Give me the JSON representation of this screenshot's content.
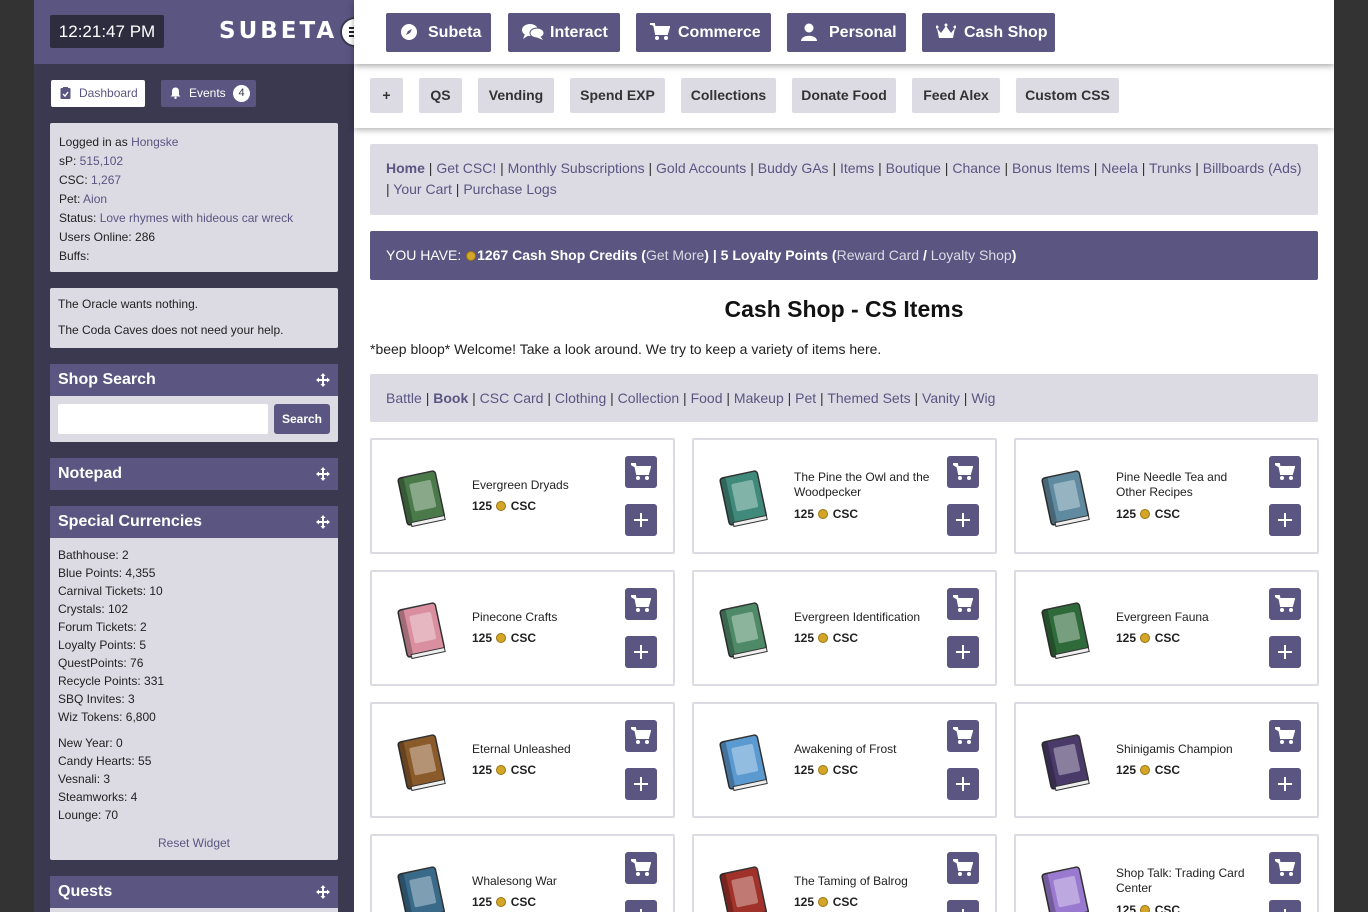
{
  "sidebar": {
    "clock": "12:21:47 PM",
    "logo": "SUBETA",
    "tabs": {
      "dashboard": "Dashboard",
      "events": "Events",
      "events_count": "4"
    },
    "info": {
      "logged_in_label": "Logged in as ",
      "username": "Hongske",
      "sp_label": "sP: ",
      "sp": "515,102",
      "csc_label": "CSC: ",
      "csc": "1,267",
      "pet_label": "Pet: ",
      "pet": "Aion",
      "status_label": "Status: ",
      "status": "Love rhymes with hideous car wreck",
      "online": "Users Online: 286",
      "buffs": "Buffs:"
    },
    "oracle": [
      "The Oracle wants nothing.",
      "The Coda Caves does not need your help."
    ],
    "shop_search": {
      "title": "Shop Search",
      "button": "Search",
      "placeholder": ""
    },
    "notepad": {
      "title": "Notepad"
    },
    "currencies": {
      "title": "Special Currencies",
      "group1": [
        "Bathhouse: 2",
        "Blue Points: 4,355",
        "Carnival Tickets: 10",
        "Crystals: 102",
        "Forum Tickets: 2",
        "Loyalty Points: 5",
        "QuestPoints: 76",
        "Recycle Points: 331",
        "SBQ Invites: 3",
        "Wiz Tokens: 6,800"
      ],
      "group2": [
        "New Year: 0",
        "Candy Hearts: 55",
        "Vesnali: 3",
        "Steamworks: 4",
        "Lounge: 70"
      ],
      "reset": "Reset Widget"
    },
    "quests": {
      "title": "Quests"
    }
  },
  "topnav": [
    "Subeta",
    "Interact",
    "Commerce",
    "Personal",
    "Cash Shop"
  ],
  "subnav": [
    "+",
    "QS",
    "Vending",
    "Spend EXP",
    "Collections",
    "Donate Food",
    "Feed Alex",
    "Custom CSS"
  ],
  "links": [
    "Home",
    "Get CSC!",
    "Monthly Subscriptions",
    "Gold Accounts",
    "Buddy GAs",
    "Items",
    "Boutique",
    "Chance",
    "Bonus Items",
    "Neela",
    "Trunks",
    "Billboards (Ads)",
    "Your Cart",
    "Purchase Logs"
  ],
  "you_have": {
    "label": "YOU HAVE: ",
    "credits": "1267",
    "credits_text": " Cash Shop Credits (",
    "get_more": "Get More",
    "mid": ") | ",
    "loyalty": "5",
    "loyalty_text": " Loyalty Points (",
    "reward_card": "Reward Card",
    "slash": " / ",
    "loyalty_shop": "Loyalty Shop",
    "end": ")"
  },
  "page_title": "Cash Shop - CS Items",
  "welcome": "*beep bloop* Welcome! Take a look around. We try to keep a variety of items here.",
  "categories": [
    "Battle",
    "Book",
    "CSC Card",
    "Clothing",
    "Collection",
    "Food",
    "Makeup",
    "Pet",
    "Themed Sets",
    "Vanity",
    "Wig"
  ],
  "active_category": "Book",
  "currency_unit": "CSC",
  "items": [
    {
      "name": "Evergreen Dryads",
      "price": "125",
      "color": "#4a7a4a"
    },
    {
      "name": "The Pine the Owl and the Woodpecker",
      "price": "125",
      "color": "#3f8a7a"
    },
    {
      "name": "Pine Needle Tea and Other Recipes",
      "price": "125",
      "color": "#5f8aa0"
    },
    {
      "name": "Pinecone Crafts",
      "price": "125",
      "color": "#d98fa0"
    },
    {
      "name": "Evergreen Identification",
      "price": "125",
      "color": "#4f8a68"
    },
    {
      "name": "Evergreen Fauna",
      "price": "125",
      "color": "#2f6a3a"
    },
    {
      "name": "Eternal Unleashed",
      "price": "125",
      "color": "#8a5a2a"
    },
    {
      "name": "Awakening of Frost",
      "price": "125",
      "color": "#5a9ad0"
    },
    {
      "name": "Shinigamis Champion",
      "price": "125",
      "color": "#4a3a6a"
    },
    {
      "name": "Whalesong War",
      "price": "125",
      "color": "#3a6a8a"
    },
    {
      "name": "The Taming of Balrog",
      "price": "125",
      "color": "#a0322a"
    },
    {
      "name": "Shop Talk: Trading Card Center",
      "price": "125",
      "color": "#9a7ad0"
    }
  ]
}
